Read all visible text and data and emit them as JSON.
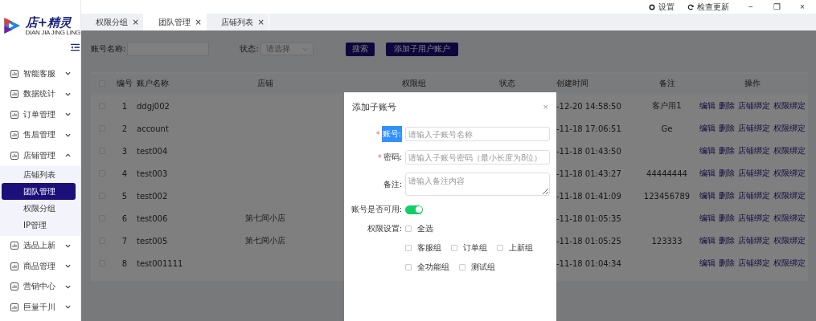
{
  "window": {
    "actions": [
      {
        "kind": "settings",
        "label": "设置"
      },
      {
        "kind": "update",
        "label": "检查更新"
      }
    ],
    "controls": [
      "−",
      "❐",
      "×"
    ]
  },
  "logo": {
    "name": "店+精灵",
    "subtitle": "DIAN JIA JING LING"
  },
  "sidebar": {
    "items": [
      {
        "label": "智能客服",
        "expanded": false
      },
      {
        "label": "数据统计",
        "expanded": false
      },
      {
        "label": "订单管理",
        "expanded": false
      },
      {
        "label": "售后管理",
        "expanded": false
      },
      {
        "label": "店铺管理",
        "expanded": true,
        "children": [
          {
            "label": "店铺列表",
            "selected": false
          },
          {
            "label": "团队管理",
            "selected": true
          },
          {
            "label": "权限分组",
            "selected": false
          },
          {
            "label": "IP管理",
            "selected": false
          }
        ]
      },
      {
        "label": "选品上新",
        "expanded": false
      },
      {
        "label": "商品管理",
        "expanded": false
      },
      {
        "label": "营销中心",
        "expanded": false
      },
      {
        "label": "巨量千川",
        "expanded": false
      }
    ]
  },
  "tabs": [
    {
      "label": "权限分组",
      "close": "×",
      "selected": false
    },
    {
      "label": "团队管理",
      "close": "×",
      "selected": true
    },
    {
      "label": "店铺列表",
      "close": "×",
      "selected": false
    }
  ],
  "filters": {
    "account_label": "账号名称:",
    "status_label": "状态:",
    "status_placeholder": "请选择",
    "search_button": "搜索",
    "add_button": "添加子用户账户"
  },
  "table": {
    "header_checked": false,
    "columns": [
      "编号",
      "账户名称",
      "店铺",
      "权限组",
      "状态",
      "创建时间",
      "备注",
      "操作"
    ],
    "rows": [
      {
        "no": "1",
        "name": "ddgj002",
        "store": "",
        "time": "-12-20 14:58:50",
        "note": "客户用1",
        "checked": false,
        "ops": [
          "编辑",
          "删除",
          "店铺绑定",
          "权限绑定"
        ]
      },
      {
        "no": "2",
        "name": "account",
        "store": "",
        "time": "-11-18 17:06:51",
        "note": "Ge",
        "checked": false,
        "ops": [
          "编辑",
          "删除",
          "店铺绑定",
          "权限绑定"
        ]
      },
      {
        "no": "3",
        "name": "test004",
        "store": "",
        "time": "-11-18 01:43:50",
        "note": "",
        "checked": false,
        "ops": [
          "编辑",
          "删除",
          "店铺绑定",
          "权限绑定"
        ]
      },
      {
        "no": "4",
        "name": "test003",
        "store": "",
        "time": "-11-18 01:43:27",
        "note": "44444444",
        "checked": false,
        "ops": [
          "编辑",
          "删除",
          "店铺绑定",
          "权限绑定"
        ]
      },
      {
        "no": "5",
        "name": "test002",
        "store": "",
        "time": "-11-18 01:41:09",
        "note": "123456789",
        "checked": false,
        "ops": [
          "编辑",
          "删除",
          "店铺绑定",
          "权限绑定"
        ]
      },
      {
        "no": "6",
        "name": "test006",
        "store": "第七间小店",
        "time": "-11-18 01:05:35",
        "note": "",
        "checked": false,
        "ops": [
          "编辑",
          "删除",
          "店铺绑定",
          "权限绑定"
        ]
      },
      {
        "no": "7",
        "name": "test005",
        "store": "第七间小店",
        "time": "-11-18 01:05:25",
        "note": "123333",
        "checked": false,
        "ops": [
          "编辑",
          "删除",
          "店铺绑定",
          "权限绑定"
        ]
      },
      {
        "no": "8",
        "name": "test001111",
        "store": "",
        "time": "-11-18 01:04:34",
        "note": "",
        "checked": false,
        "ops": [
          "编辑",
          "删除",
          "店铺绑定",
          "权限绑定"
        ]
      }
    ]
  },
  "dialog": {
    "title": "添加子账号",
    "close": "×",
    "fields": [
      {
        "label": "账号:",
        "required_mark": "*",
        "highlighted": true,
        "kind": "input",
        "placeholder": "请输入子账号名称"
      },
      {
        "label": "密码:",
        "required_mark": "*",
        "highlighted": false,
        "kind": "input",
        "placeholder": "请输入子账号密码（最小长度为8位）"
      },
      {
        "label": "备注:",
        "highlighted": false,
        "kind": "textarea",
        "placeholder": "请输入备注内容"
      }
    ],
    "enabled_label": "账号是否可用:",
    "enabled": true,
    "permissions_label": "权限设置:",
    "permission_rows": [
      [
        {
          "label": "全选",
          "checked": false
        }
      ],
      [
        {
          "label": "客服组",
          "checked": false
        },
        {
          "label": "订单组",
          "checked": false
        },
        {
          "label": "上新组",
          "checked": false
        }
      ],
      [
        {
          "label": "全功能组",
          "checked": false
        },
        {
          "label": "测试组",
          "checked": false
        }
      ]
    ]
  }
}
